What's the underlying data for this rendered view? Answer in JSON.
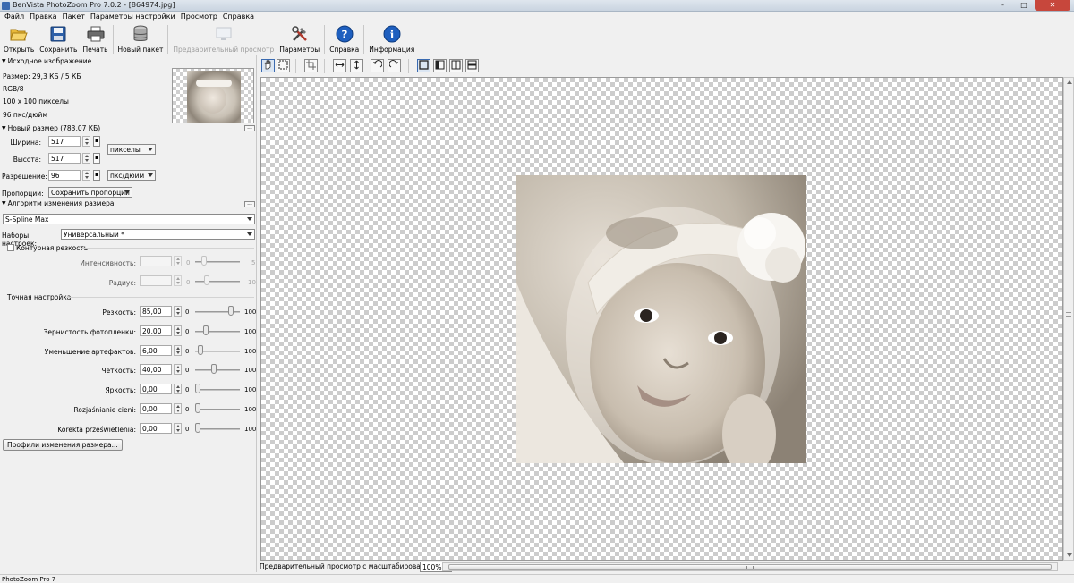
{
  "window": {
    "title": "BenVista PhotoZoom Pro 7.0.2 - [864974.jpg]",
    "controls": [
      "–",
      "□",
      "✕"
    ]
  },
  "menu": [
    "Файл",
    "Правка",
    "Пакет",
    "Параметры настройки",
    "Просмотр",
    "Справка"
  ],
  "toolbar": {
    "open": "Открыть",
    "save": "Сохранить",
    "print": "Печать",
    "new_batch": "Новый пакет",
    "preview": "Предварительный просмотр",
    "settings": "Параметры",
    "help": "Справка",
    "info": "Информация"
  },
  "source": {
    "header": "Исходное изображение",
    "size": "Размер: 29,3 КБ / 5 КБ",
    "color_mode": "RGB/8",
    "dimensions": "100 x 100 пикселы",
    "dpi": "96 пкс/дюйм"
  },
  "new_size": {
    "header": "Новый размер (783,07 КБ)",
    "width_label": "Ширина:",
    "width_value": "517",
    "height_label": "Высота:",
    "height_value": "517",
    "unit": "пикселы",
    "resolution_label": "Разрешение:",
    "resolution_value": "96",
    "resolution_unit": "пкс/дюйм",
    "proportions_label": "Пропорции:",
    "proportions_value": "Сохранить пропорции"
  },
  "algorithm": {
    "header": "Алгоритм изменения размера",
    "method": "S-Spline Max",
    "presets_label": "Наборы настроек:",
    "presets_value": "Универсальный *"
  },
  "contour": {
    "checkbox_label": "Контурная резкость",
    "checked": false,
    "intensity_label": "Интенсивность:",
    "intensity_min": "0",
    "intensity_max": "5",
    "radius_label": "Радиус:",
    "radius_min": "0",
    "radius_max": "10"
  },
  "fine_tuning": {
    "header": "Точная настройка",
    "rows": [
      {
        "label": "Резкость:",
        "value": "85,00",
        "min": "0",
        "max": "100",
        "level": 0.85
      },
      {
        "label": "Зернистость фотопленки:",
        "value": "20,00",
        "min": "0",
        "max": "100",
        "level": 0.2
      },
      {
        "label": "Уменьшение артефактов:",
        "value": "6,00",
        "min": "0",
        "max": "100",
        "level": 0.06
      },
      {
        "label": "Четкость:",
        "value": "40,00",
        "min": "0",
        "max": "100",
        "level": 0.4
      },
      {
        "label": "Яркость:",
        "value": "0,00",
        "min": "0",
        "max": "100",
        "level": 0.0
      },
      {
        "label": "Rozjaśnianie cieni:",
        "value": "0,00",
        "min": "0",
        "max": "100",
        "level": 0.0
      },
      {
        "label": "Korekta prześwietlenia:",
        "value": "0,00",
        "min": "0",
        "max": "100",
        "level": 0.0
      }
    ],
    "profiles_button": "Профили изменения размера..."
  },
  "view": {
    "zoom_label": "Предварительный просмотр с масштабированием:",
    "zoom_value": "100%"
  },
  "status": "PhotoZoom Pro 7",
  "icons": {
    "open": "folder-open-icon",
    "save": "floppy-disk-icon",
    "print": "printer-icon",
    "new_batch": "batch-stack-icon",
    "preview": "monitor-icon",
    "settings": "tools-icon",
    "help": "help-question-icon",
    "info": "info-icon"
  },
  "colors": {
    "accent": "#1e5fbf",
    "canvas_check": "#cccccc"
  }
}
